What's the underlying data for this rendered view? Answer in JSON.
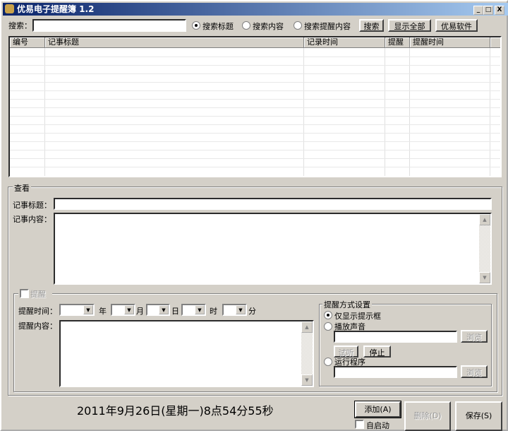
{
  "window": {
    "title": "优易电子提醒簿 1.2",
    "minimize": "_",
    "maximize": "□",
    "close": "X"
  },
  "search": {
    "label": "搜索：",
    "value": "",
    "options": [
      "搜索标题",
      "搜索内容",
      "搜索提醒内容"
    ],
    "selected": 0,
    "search_btn": "搜索",
    "show_all_btn": "显示全部",
    "software_btn": "优易软件"
  },
  "list": {
    "columns": [
      "编号",
      "记事标题",
      "记录时间",
      "提醒",
      "提醒时间"
    ],
    "rows": []
  },
  "view": {
    "legend": "查看",
    "title_label": "记事标题：",
    "title_value": "",
    "content_label": "记事内容：",
    "content_value": ""
  },
  "reminder": {
    "legend": "提醒",
    "checked": false,
    "time_label": "提醒时间：",
    "units": [
      "年",
      "月",
      "日",
      "时",
      "分"
    ],
    "content_label": "提醒内容：",
    "content_value": "",
    "method": {
      "legend": "提醒方式设置",
      "options": [
        "仅显示提示框",
        "播放声音",
        "运行程序"
      ],
      "selected": 0,
      "browse": "浏览",
      "listen": "试听",
      "stop": "停止"
    }
  },
  "footer": {
    "datetime": "2011年9月26日(星期一)8点54分55秒",
    "add": "添加(A)",
    "delete": "删除(D)",
    "save": "保存(S)",
    "autostart": "自启动"
  }
}
